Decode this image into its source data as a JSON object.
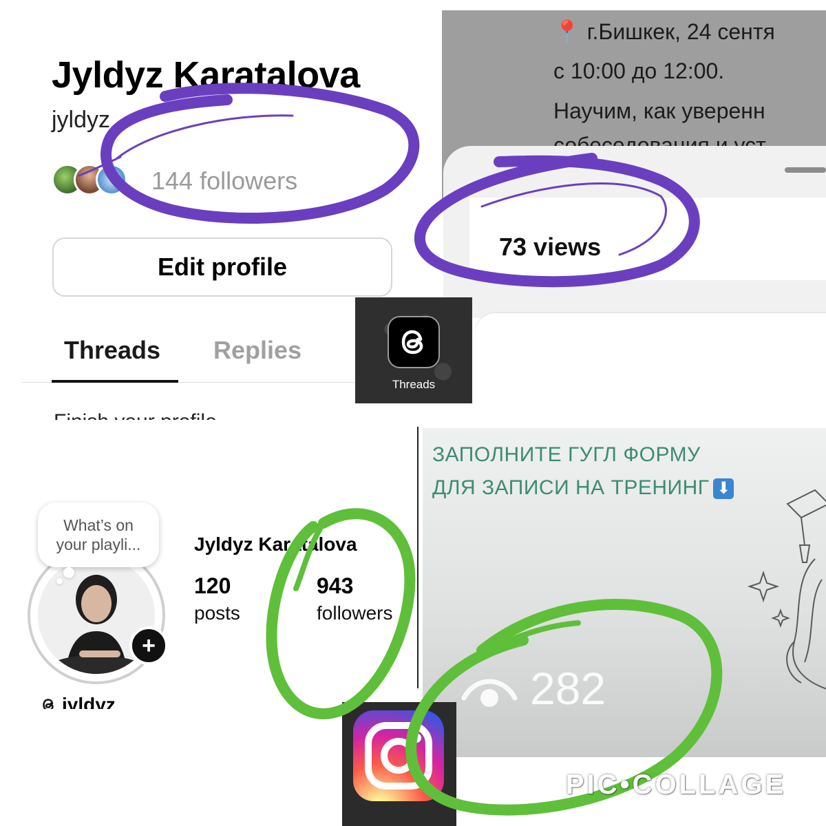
{
  "threads_profile": {
    "name": "Jyldyz Karatalova",
    "handle": "jyldyz",
    "followers": "144 followers",
    "edit_button": "Edit profile",
    "tabs": [
      "Threads",
      "Replies"
    ],
    "cutoff_text": "Finish your profile"
  },
  "views_screenshot": {
    "post_lines": [
      "📍 г.Бишкек, 24 сентя",
      "с 10:00 до 12:00.",
      "Научим, как уверенн",
      "собеседования и уст"
    ],
    "views": "73 views"
  },
  "threads_app": {
    "label": "Threads",
    "icon": "threads-logo-icon"
  },
  "instagram_profile": {
    "note_bubble": [
      "What’s on",
      "your playli..."
    ],
    "name": "Jyldyz Karatalova",
    "stats": [
      {
        "value": "120",
        "label": "posts"
      },
      {
        "value": "943",
        "label": "followers"
      }
    ],
    "threads_handle": "jyldyz",
    "add_icon": "plus-icon"
  },
  "story": {
    "lines": [
      "ЗАПОЛНИТЕ ГУГЛ ФОРМУ",
      "ДЛЯ ЗАПИСИ НА ТРЕНИНГ"
    ],
    "arrow": "⬇",
    "views": "282",
    "eye_icon": "eye-icon"
  },
  "instagram_app": {
    "icon": "instagram-logo-icon"
  },
  "watermark": "PIC•COLLAGE",
  "colors": {
    "purple_mark": "#6a3fbf",
    "green_mark": "#5fbf3a",
    "story_text": "#3d8b75",
    "arrow_badge": "#3a86d0"
  }
}
